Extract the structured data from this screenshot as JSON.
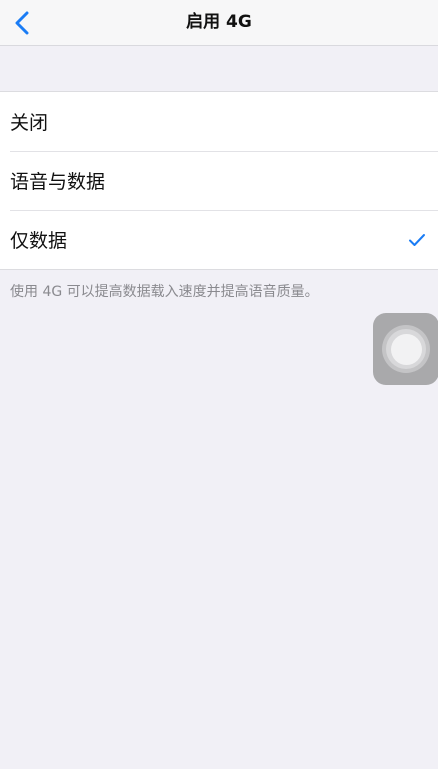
{
  "nav": {
    "title": "启用 4G",
    "back_icon": "chevron-left-icon"
  },
  "options": [
    {
      "label": "关闭",
      "selected": false
    },
    {
      "label": "语音与数据",
      "selected": false
    },
    {
      "label": "仅数据",
      "selected": true
    }
  ],
  "footnote": "使用 4G 可以提高数据载入速度并提高语音质量。",
  "colors": {
    "accent": "#1a7cf5",
    "background": "#f1f0f6",
    "cell": "#ffffff",
    "secondary_text": "#8a8a8f"
  },
  "assistive_touch_icon": "assistive-touch-icon"
}
